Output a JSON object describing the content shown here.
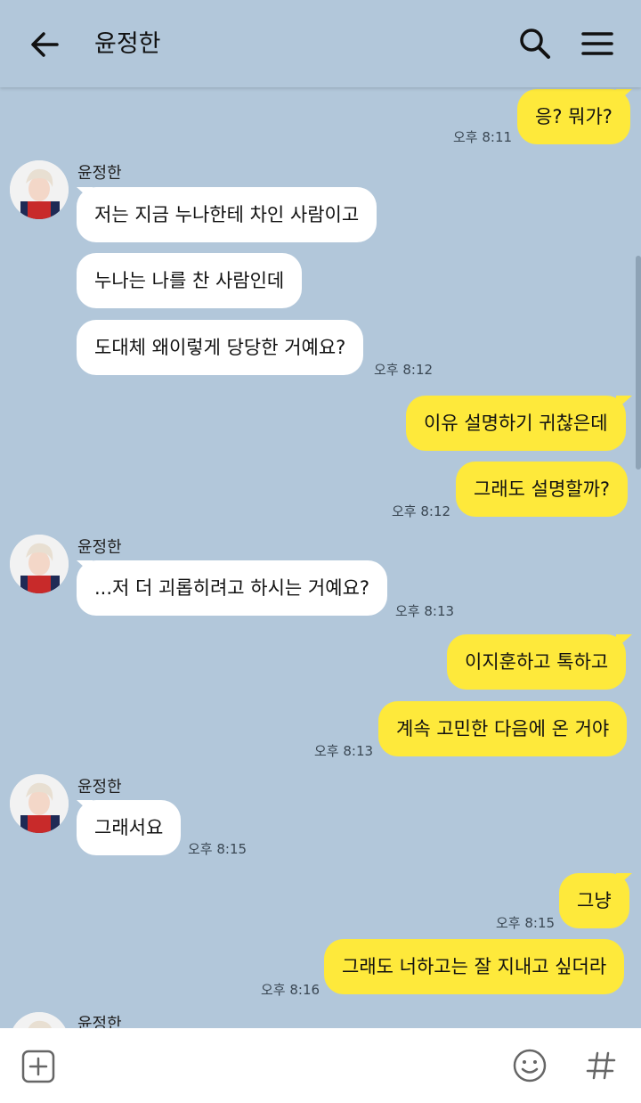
{
  "header": {
    "title": "윤정한",
    "back_icon": "back-arrow-icon",
    "search_icon": "search-icon",
    "menu_icon": "hamburger-menu-icon",
    "background": "#b2c7da"
  },
  "colors": {
    "my_bubble": "#fee93b",
    "their_bubble": "#ffffff",
    "chat_background": "#b2c7da"
  },
  "messages": [
    {
      "from": "me",
      "text": "응? 뭐가?"
    },
    {
      "from": "me",
      "time": "오후 8:11"
    },
    {
      "from": "them",
      "sender": "윤정한",
      "text": "저는 지금 누나한테 차인 사람이고"
    },
    {
      "from": "them",
      "text": "누나는 나를 찬 사람인데"
    },
    {
      "from": "them",
      "text": "도대체 왜이렇게 당당한 거예요?",
      "time": "오후 8:12"
    },
    {
      "from": "me",
      "text": "이유 설명하기 귀찮은데"
    },
    {
      "from": "me",
      "text": "그래도 설명할까?",
      "time": "오후 8:12"
    },
    {
      "from": "them",
      "sender": "윤정한",
      "text": "...저 더 괴롭히려고 하시는 거예요?",
      "time": "오후 8:13"
    },
    {
      "from": "me",
      "text": "이지훈하고 톡하고"
    },
    {
      "from": "me",
      "text": "계속 고민한 다음에 온 거야",
      "time": "오후 8:13"
    },
    {
      "from": "them",
      "sender": "윤정한",
      "text": "그래서요",
      "time": "오후 8:15"
    },
    {
      "from": "me",
      "text": "그냥",
      "time": "오후 8:15"
    },
    {
      "from": "me",
      "text": "그래도 너하고는 잘 지내고 싶더라",
      "time": "오후 8:16"
    },
    {
      "from": "them",
      "sender": "윤정한"
    }
  ],
  "bottom_bar": {
    "add_icon": "add-square-icon",
    "emoji_icon": "emoji-icon",
    "hash_icon": "hashtag-icon"
  }
}
